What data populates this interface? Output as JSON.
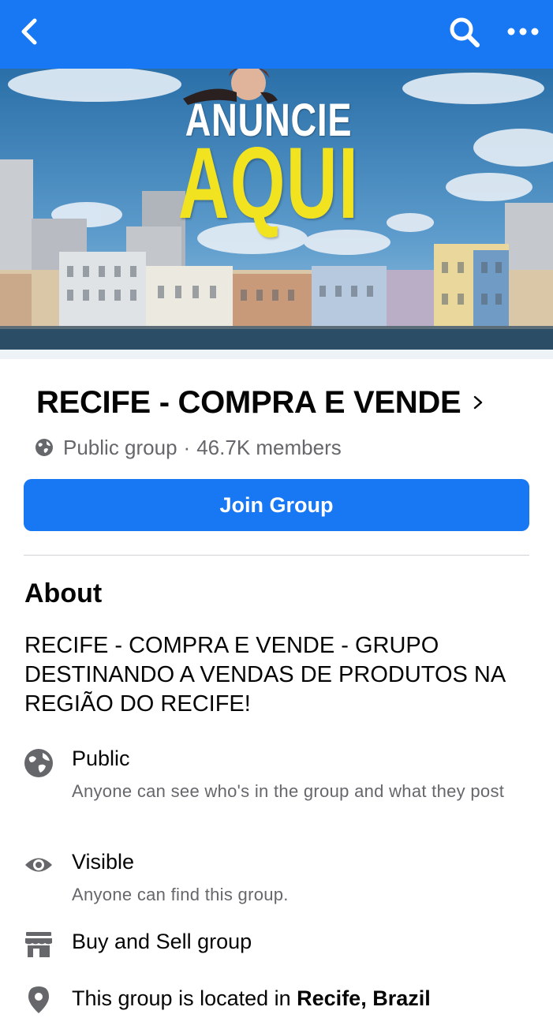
{
  "header": {
    "back_icon": "chevron-left-icon",
    "search_icon": "search-icon",
    "more_icon": "more-icon",
    "color": "#1877f2"
  },
  "cover": {
    "line1": "ANUNCIE",
    "line2": "AQUI"
  },
  "group": {
    "name": "RECIFE - COMPRA E VENDE",
    "privacy": "Public group",
    "separator": "·",
    "members": "46.7K members",
    "join_label": "Join Group"
  },
  "about": {
    "heading": "About",
    "description": "RECIFE - COMPRA E VENDE - GRUPO DESTINANDO A VENDAS DE PRODUTOS NA REGIÃO DO RECIFE!",
    "items": [
      {
        "icon": "globe-icon",
        "title": "Public",
        "subtitle": "Anyone can see who's in the group and what they post"
      },
      {
        "icon": "eye-icon",
        "title": "Visible",
        "subtitle": "Anyone can find this group."
      },
      {
        "icon": "store-icon",
        "title": "Buy and Sell group"
      },
      {
        "icon": "location-pin-icon",
        "title_prefix": "This group is located in ",
        "title_bold": "Recife, Brazil"
      }
    ]
  }
}
